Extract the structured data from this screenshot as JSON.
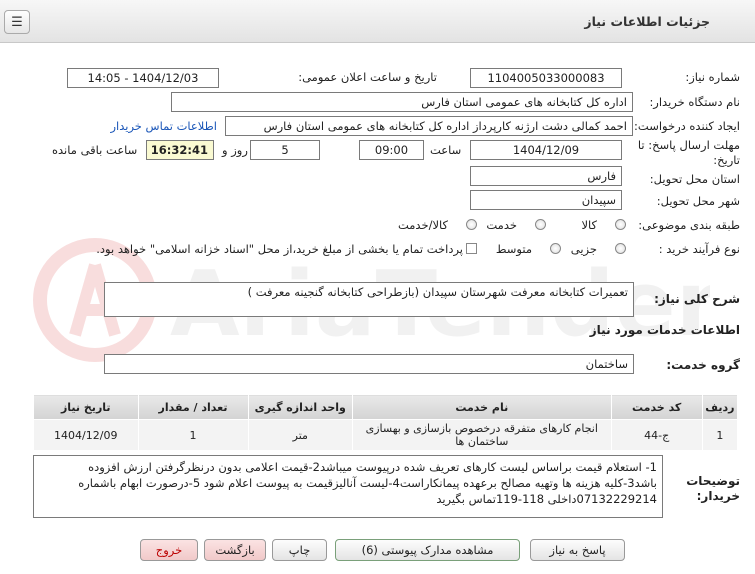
{
  "header": {
    "title": "جزئیات اطلاعات نیاز",
    "menu_icon": "hamburger-icon"
  },
  "fields": {
    "need_number_label": "شماره نیاز:",
    "need_number": "1104005033000083",
    "announce_label": "تاریخ و ساعت اعلان عمومی:",
    "announce_value": "1404/12/03 - 14:05",
    "buyer_label": "نام دستگاه خریدار:",
    "buyer_value": "اداره کل کتابخانه های عمومی استان فارس",
    "creator_label": "ایجاد کننده درخواست:",
    "creator_value": "احمد  کمالی دشت ارژنه  کارپرداز اداره کل کتابخانه های عمومی استان فارس",
    "contact_link": "اطلاعات تماس خریدار",
    "deadline_label_1": "مهلت ارسال پاسخ: تا",
    "deadline_label_2": "تاریخ:",
    "deadline_date": "1404/12/09",
    "time_label": "ساعت",
    "deadline_time": "09:00",
    "days_value": "5",
    "days_label": "روز و",
    "remaining_time": "16:32:41",
    "remaining_label": "ساعت باقی مانده",
    "province_label": "استان محل تحویل:",
    "province_value": "فارس",
    "city_label": "شهر محل تحویل:",
    "city_value": "سپیدان",
    "category_label": "طبقه بندی موضوعی:",
    "category_options": [
      "کالا",
      "خدمت",
      "کالا/خدمت"
    ],
    "process_label": "نوع فرآیند خرید :",
    "process_options": [
      "جزیی",
      "متوسط"
    ],
    "payment_note": "پرداخت تمام یا بخشی از مبلغ خرید،از محل \"اسناد خزانه اسلامی\" خواهد بود."
  },
  "summary": {
    "label": "شرح کلی نیاز:",
    "value": "تعمیرات کتابخانه معرفت شهرستان سپیدان (بازطراحی کتابخانه گنجینه معرفت )"
  },
  "services_heading": "اطلاعات خدمات مورد نیاز",
  "service_group": {
    "label": "گروه خدمت:",
    "value": "ساختمان"
  },
  "table": {
    "headers": [
      "ردیف",
      "کد خدمت",
      "نام خدمت",
      "واحد اندازه گیری",
      "تعداد / مقدار",
      "تاریخ نیاز"
    ],
    "rows": [
      [
        "1",
        "ج-44",
        "انجام کارهای متفرقه درخصوص بازسازی و بهسازی ساختمان ها",
        "متر",
        "1",
        "1404/12/09"
      ]
    ]
  },
  "buyer_notes": {
    "label_1": "توضیحات",
    "label_2": "خریدار:",
    "lines": [
      "1- استعلام قیمت براساس لیست کارهای تعریف شده درپیوست میباشد2-قیمت اعلامی بدون درنظرگرفتن ارزش افزوده",
      "باشد3-کلیه هزینه ها وتهیه مصالح برعهده پیمانکاراست4-لیست آنالیزقیمت به پیوست اعلام شود 5-درصورت ابهام باشماره",
      "07132229214داخلی 118-119تماس بگیرید"
    ]
  },
  "buttons": {
    "reply": "پاسخ به نیاز",
    "attachments": "مشاهده مدارک پیوستی (6)",
    "print": "چاپ",
    "back": "بازگشت",
    "exit": "خروج"
  }
}
